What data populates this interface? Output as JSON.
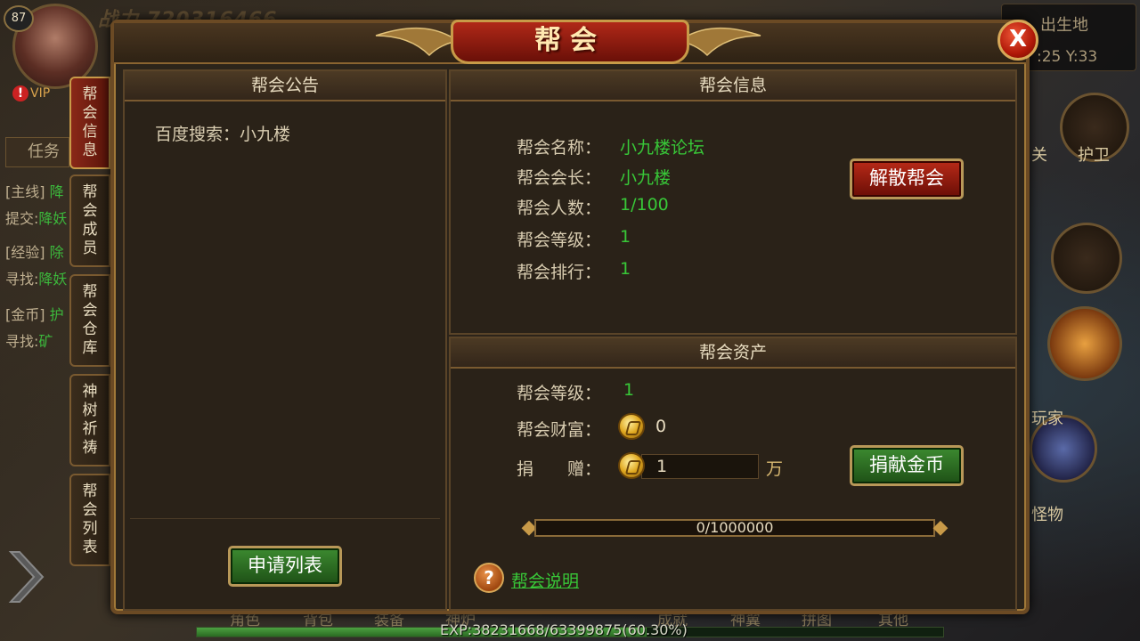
{
  "hud": {
    "level": "87",
    "vip": "VIP",
    "power": "战力 720316466",
    "map_name": "出生地",
    "coords": ":25 Y:33",
    "right_labels": [
      "关",
      "护卫",
      "玩家",
      "怪物"
    ],
    "bottom_labels": [
      "角色",
      "背包",
      "装备",
      "神炉",
      "成就",
      "神翼",
      "拼图",
      "其他"
    ],
    "exp_text": "EXP:38231668/63399875(60.30%)",
    "exp_fraction": 0.603
  },
  "tasks": {
    "tab_label": "任务",
    "lines": [
      {
        "tag": "[主线]",
        "text": "降"
      },
      {
        "tag": "提交:",
        "text": "降妖"
      },
      {
        "tag": "[经验]",
        "text": "除"
      },
      {
        "tag": "寻找:",
        "text": "降妖"
      },
      {
        "tag": "[金币]",
        "text": "护"
      },
      {
        "tag": "寻找:",
        "text": "矿"
      }
    ]
  },
  "dialog": {
    "title": "帮会",
    "close_label": "X",
    "side_tabs": [
      {
        "label": "帮会信息",
        "active": true
      },
      {
        "label": "帮会成员",
        "active": false
      },
      {
        "label": "帮会仓库",
        "active": false
      },
      {
        "label": "神树祈祷",
        "active": false
      },
      {
        "label": "帮会列表",
        "active": false
      }
    ],
    "notice": {
      "header": "帮会公告",
      "text": "百度搜索：小九楼",
      "apply_button": "申请列表"
    },
    "info": {
      "header": "帮会信息",
      "rows": [
        {
          "label": "帮会名称：",
          "value": "小九楼论坛"
        },
        {
          "label": "帮会会长：",
          "value": "小九楼"
        },
        {
          "label": "帮会人数：",
          "value": "1/100"
        },
        {
          "label": "帮会等级：",
          "value": "1"
        },
        {
          "label": "帮会排行：",
          "value": "1"
        }
      ],
      "disband_button": "解散帮会"
    },
    "assets": {
      "header": "帮会资产",
      "level_label": "帮会等级：",
      "level_value": "1",
      "wealth_label": "帮会财富：",
      "wealth_value": "0",
      "donate_label": "捐　　赠：",
      "donate_value": "1",
      "donate_unit": "万",
      "donate_button": "捐献金币",
      "progress_text": "0/1000000",
      "progress_fraction": 0,
      "help_link": "帮会说明"
    }
  },
  "colors": {
    "accent_gold": "#c89a48",
    "value_green": "#38c838",
    "title_red": "#b02818"
  }
}
